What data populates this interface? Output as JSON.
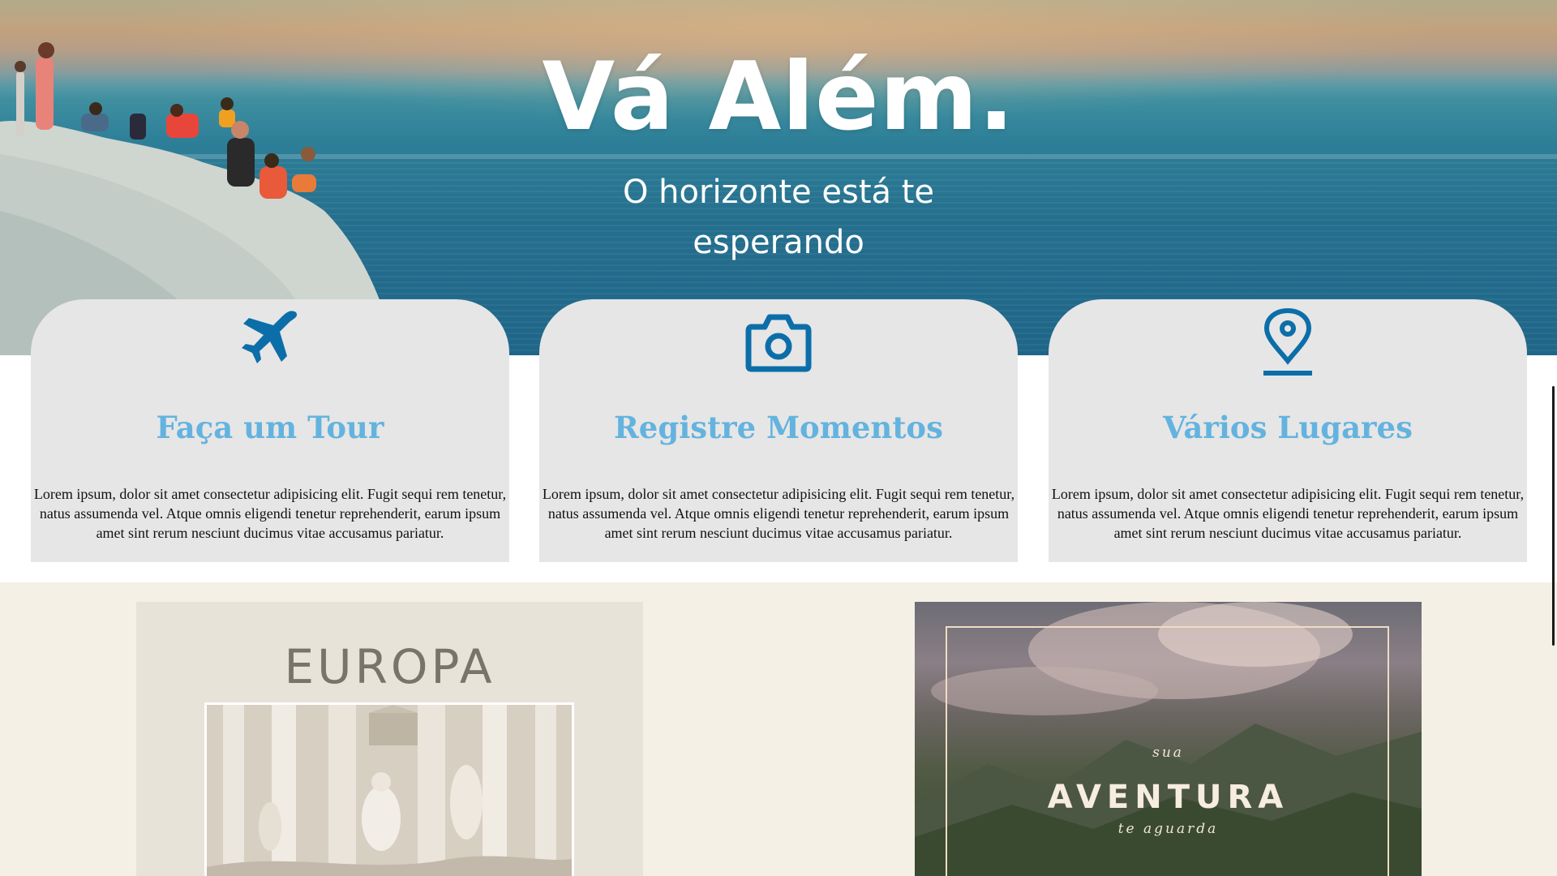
{
  "hero": {
    "title": "Vá Além.",
    "subtitle": "O horizonte está te esperando"
  },
  "colors": {
    "accent_icon": "#0c6ea9",
    "card_title": "#64b3df",
    "card_bg": "#e6e6e6",
    "section_bg": "#f4f0e6"
  },
  "cards": [
    {
      "icon": "airplane-icon",
      "title": "Faça um Tour",
      "text": "Lorem ipsum, dolor sit amet consectetur adipisicing elit. Fugit sequi rem tenetur, natus assumenda vel. Atque omnis eligendi tenetur reprehenderit, earum ipsum amet sint rerum nesciunt ducimus vitae accusamus pariatur."
    },
    {
      "icon": "camera-icon",
      "title": "Registre Momentos",
      "text": "Lorem ipsum, dolor sit amet consectetur adipisicing elit. Fugit sequi rem tenetur, natus assumenda vel. Atque omnis eligendi tenetur reprehenderit, earum ipsum amet sint rerum nesciunt ducimus vitae accusamus pariatur."
    },
    {
      "icon": "map-pin-icon",
      "title": "Vários Lugares",
      "text": "Lorem ipsum, dolor sit amet consectetur adipisicing elit. Fugit sequi rem tenetur, natus assumenda vel. Atque omnis eligendi tenetur reprehenderit, earum ipsum amet sint rerum nesciunt ducimus vitae accusamus pariatur."
    }
  ],
  "destinations": {
    "europa": {
      "title": "EUROPA"
    },
    "aventura": {
      "top": "sua",
      "main": "AVENTURA",
      "bottom": "te aguarda"
    }
  }
}
